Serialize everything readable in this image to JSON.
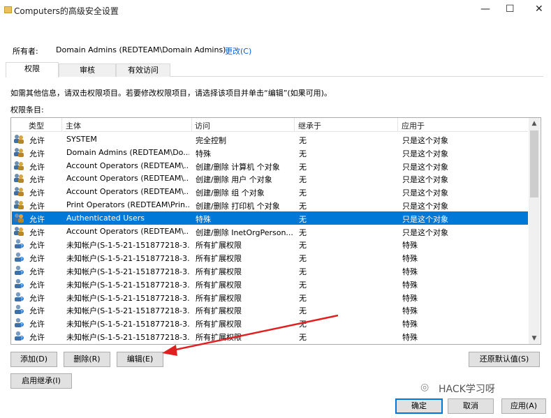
{
  "window": {
    "title": "Computers的高级安全设置",
    "minimize": "—",
    "maximize": "☐",
    "close": "✕"
  },
  "owner": {
    "label": "所有者:",
    "value": "Domain Admins (REDTEAM\\Domain Admins)",
    "change_link": "更改(C)"
  },
  "tabs": [
    {
      "label": "权限",
      "active": true
    },
    {
      "label": "审核",
      "active": false
    },
    {
      "label": "有效访问",
      "active": false
    }
  ],
  "info_text": "如需其他信息，请双击权限项目。若要修改权限项目，请选择该项目并单击“编辑”(如果可用)。",
  "entries_label": "权限条目:",
  "columns": {
    "type": "类型",
    "principal": "主体",
    "access": "访问",
    "inherited_from": "继承于",
    "applies_to": "应用于"
  },
  "rows": [
    {
      "icon": "user-group-icon",
      "type": "允许",
      "principal": "SYSTEM",
      "access": "完全控制",
      "inherited_from": "无",
      "applies_to": "只是这个对象"
    },
    {
      "icon": "user-group-icon",
      "type": "允许",
      "principal": "Domain Admins (REDTEAM\\Do...",
      "access": "特殊",
      "inherited_from": "无",
      "applies_to": "只是这个对象"
    },
    {
      "icon": "user-group-icon",
      "type": "允许",
      "principal": "Account Operators (REDTEAM\\...",
      "access": "创建/删除 计算机 个对象",
      "inherited_from": "无",
      "applies_to": "只是这个对象"
    },
    {
      "icon": "user-group-icon",
      "type": "允许",
      "principal": "Account Operators (REDTEAM\\...",
      "access": "创建/删除 用户 个对象",
      "inherited_from": "无",
      "applies_to": "只是这个对象"
    },
    {
      "icon": "user-group-icon",
      "type": "允许",
      "principal": "Account Operators (REDTEAM\\...",
      "access": "创建/删除 组 个对象",
      "inherited_from": "无",
      "applies_to": "只是这个对象"
    },
    {
      "icon": "user-group-icon",
      "type": "允许",
      "principal": "Print Operators (REDTEAM\\Prin...",
      "access": "创建/删除 打印机 个对象",
      "inherited_from": "无",
      "applies_to": "只是这个对象"
    },
    {
      "icon": "user-group-icon",
      "type": "允许",
      "principal": "Authenticated Users",
      "access": "特殊",
      "inherited_from": "无",
      "applies_to": "只是这个对象",
      "selected": true
    },
    {
      "icon": "user-group-icon",
      "type": "允许",
      "principal": "Account Operators (REDTEAM\\...",
      "access": "创建/删除 InetOrgPerson...",
      "inherited_from": "无",
      "applies_to": "只是这个对象"
    },
    {
      "icon": "unknown-user-icon",
      "type": "允许",
      "principal": "未知帐户(S-1-5-21-151877218-3...",
      "access": "所有扩展权限",
      "inherited_from": "无",
      "applies_to": "特殊"
    },
    {
      "icon": "unknown-user-icon",
      "type": "允许",
      "principal": "未知帐户(S-1-5-21-151877218-3...",
      "access": "所有扩展权限",
      "inherited_from": "无",
      "applies_to": "特殊"
    },
    {
      "icon": "unknown-user-icon",
      "type": "允许",
      "principal": "未知帐户(S-1-5-21-151877218-3...",
      "access": "所有扩展权限",
      "inherited_from": "无",
      "applies_to": "特殊"
    },
    {
      "icon": "unknown-user-icon",
      "type": "允许",
      "principal": "未知帐户(S-1-5-21-151877218-3...",
      "access": "所有扩展权限",
      "inherited_from": "无",
      "applies_to": "特殊"
    },
    {
      "icon": "unknown-user-icon",
      "type": "允许",
      "principal": "未知帐户(S-1-5-21-151877218-3...",
      "access": "所有扩展权限",
      "inherited_from": "无",
      "applies_to": "特殊"
    },
    {
      "icon": "unknown-user-icon",
      "type": "允许",
      "principal": "未知帐户(S-1-5-21-151877218-3...",
      "access": "所有扩展权限",
      "inherited_from": "无",
      "applies_to": "特殊"
    },
    {
      "icon": "unknown-user-icon",
      "type": "允许",
      "principal": "未知帐户(S-1-5-21-151877218-3...",
      "access": "所有扩展权限",
      "inherited_from": "无",
      "applies_to": "特殊"
    },
    {
      "icon": "unknown-user-icon",
      "type": "允许",
      "principal": "未知帐户(S-1-5-21-151877218-3...",
      "access": "所有扩展权限",
      "inherited_from": "无",
      "applies_to": "特殊"
    }
  ],
  "buttons": {
    "add": "添加(D)",
    "remove": "删除(R)",
    "edit": "编辑(E)",
    "restore_defaults": "还原默认值(S)",
    "enable_inheritance": "启用继承(I)",
    "ok": "确定",
    "cancel": "取消",
    "apply": "应用(A)"
  },
  "watermark": "HACK学习呀",
  "colors": {
    "selection": "#0078d7",
    "link": "#0a5ccf",
    "annotation_arrow": "#e02020"
  }
}
